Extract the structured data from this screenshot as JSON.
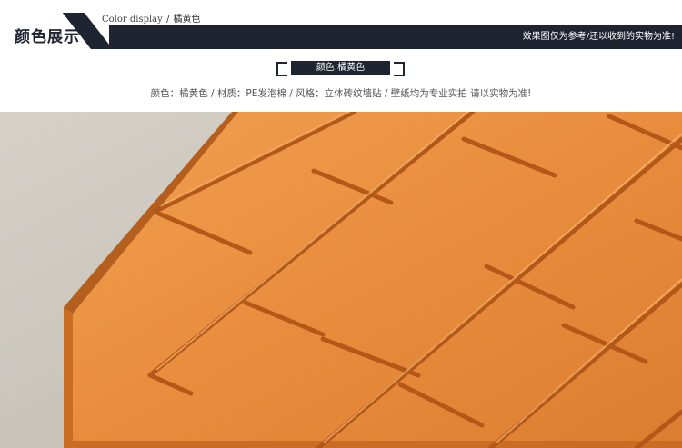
{
  "header": {
    "en_label": "Color display",
    "sep": "/",
    "cn_label": "橘黄色",
    "title": "颜色展示",
    "note": "效果图仅为参考/还以收到的实物为准!"
  },
  "tag": {
    "label": "颜色:橘黄色"
  },
  "description": "颜色：橘黄色 / 材质：PE发泡棉 / 风格：立体砖纹墙贴 / 壁纸均为专业实拍 请以实物为准!",
  "colors": {
    "band": "#1e2430",
    "brick": "#e58a3c",
    "brick_shadow": "#b95f1c",
    "cloth": "#cbc6bd"
  }
}
